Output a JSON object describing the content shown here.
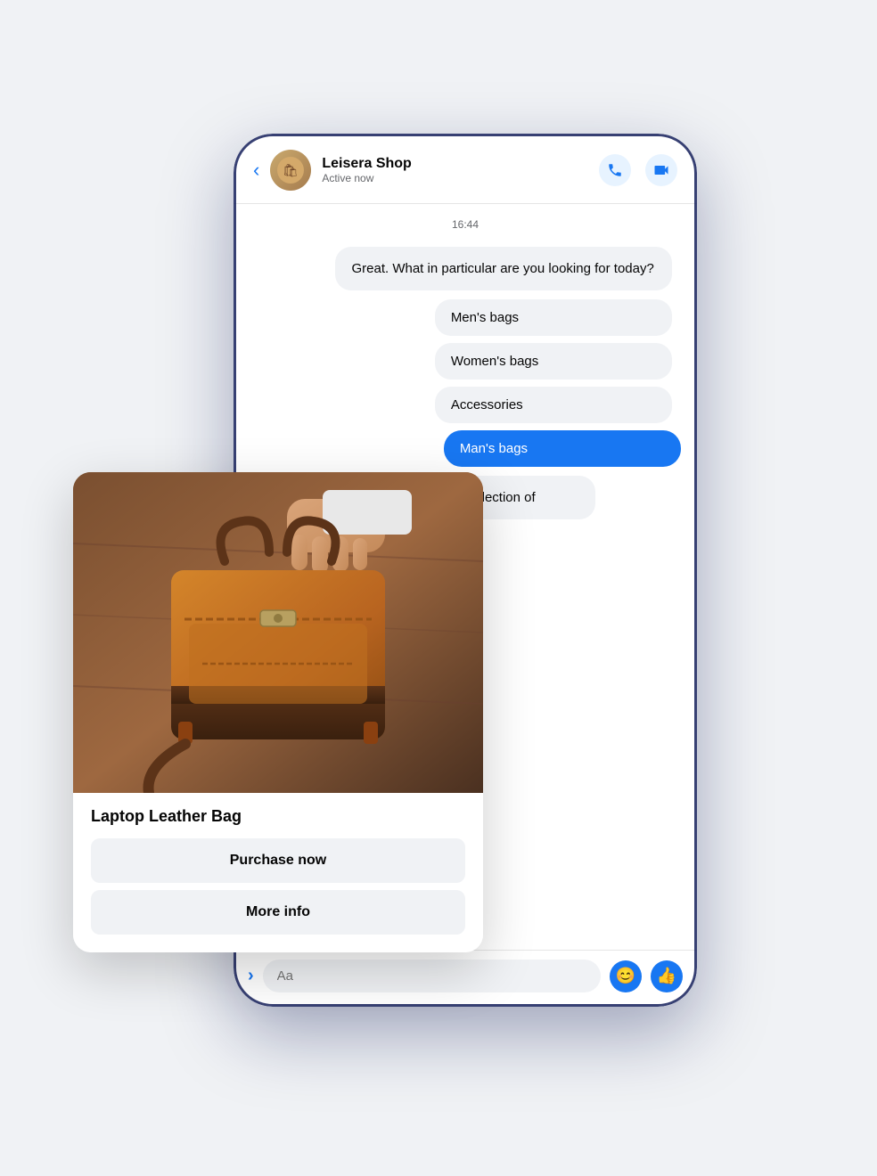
{
  "header": {
    "back_label": "‹",
    "shop_name": "Leisera Shop",
    "shop_status": "Active now",
    "call_icon": "phone",
    "video_icon": "video-camera"
  },
  "chat": {
    "timestamp": "16:44",
    "messages": [
      {
        "type": "bot",
        "text": "Great. What in particular are you looking for today?"
      },
      {
        "type": "option",
        "text": "Men's bags"
      },
      {
        "type": "option",
        "text": "Women's bags"
      },
      {
        "type": "option",
        "text": "Accessories"
      },
      {
        "type": "user",
        "text": "Man's bags"
      },
      {
        "type": "shop",
        "text": "...era Shop you will find the best selection of"
      }
    ],
    "input_placeholder": "Aa"
  },
  "product_card": {
    "product_name": "Laptop Leather Bag",
    "btn_purchase": "Purchase now",
    "btn_info": "More info",
    "image_alt": "Brown leather laptop bag"
  }
}
